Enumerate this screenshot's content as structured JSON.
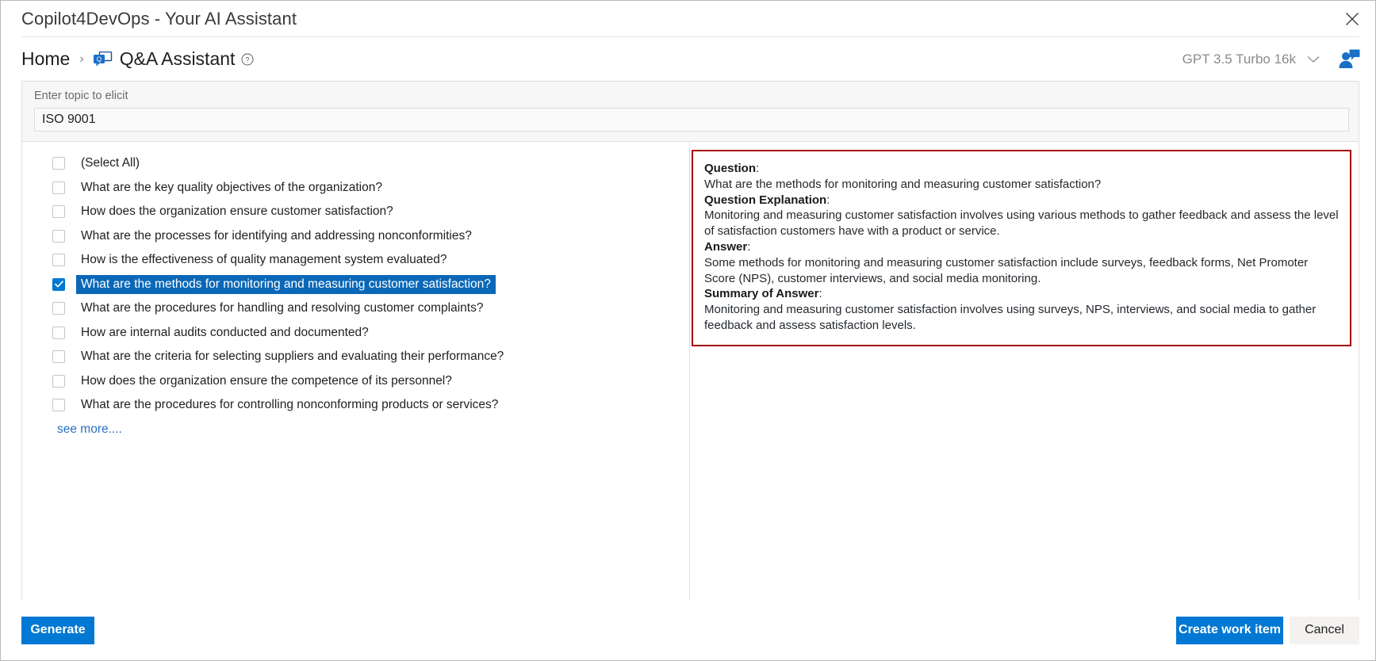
{
  "titlebar": {
    "app_title": "Copilot4DevOps - Your AI Assistant",
    "close_label": "close-icon"
  },
  "breadcrumb": {
    "home": "Home",
    "separator": "›",
    "current": "Q&A Assistant",
    "page_icon": "qa-assistant-icon",
    "help_icon": "help-circle-icon"
  },
  "header_right": {
    "model": "GPT 3.5 Turbo 16k",
    "chevron": "chevron-down-icon",
    "user_icon": "user-chat-icon"
  },
  "topic": {
    "label": "Enter topic to elicit",
    "value": "ISO 9001",
    "placeholder": "Enter topic to elicit"
  },
  "questions": [
    {
      "label": "(Select All)",
      "selected": false
    },
    {
      "label": "What are the key quality objectives of the organization?",
      "selected": false
    },
    {
      "label": "How does the organization ensure customer satisfaction?",
      "selected": false
    },
    {
      "label": "What are the processes for identifying and addressing nonconformities?",
      "selected": false
    },
    {
      "label": "How is the effectiveness of quality management system evaluated?",
      "selected": false
    },
    {
      "label": "What are the methods for monitoring and measuring customer satisfaction?",
      "selected": true
    },
    {
      "label": "What are the procedures for handling and resolving customer complaints?",
      "selected": false
    },
    {
      "label": "How are internal audits conducted and documented?",
      "selected": false
    },
    {
      "label": "What are the criteria for selecting suppliers and evaluating their performance?",
      "selected": false
    },
    {
      "label": "How does the organization ensure the competence of its personnel?",
      "selected": false
    },
    {
      "label": "What are the procedures for controlling nonconforming products or services?",
      "selected": false
    }
  ],
  "see_more": "see more....",
  "answer_card": {
    "question_heading": "Question",
    "question_text": "What are the methods for monitoring and measuring customer satisfaction?",
    "explanation_heading": "Question Explanation",
    "explanation_text": "Monitoring and measuring customer satisfaction involves using various methods to gather feedback and assess the level of satisfaction customers have with a product or service.",
    "answer_heading": "Answer",
    "answer_text": "Some methods for monitoring and measuring customer satisfaction include surveys, feedback forms, Net Promoter Score (NPS), customer interviews, and social media monitoring.",
    "summary_heading": "Summary of Answer",
    "summary_text": "Monitoring and measuring customer satisfaction involves using surveys, NPS, interviews, and social media to gather feedback and assess satisfaction levels.",
    "colon": ":",
    "border_color": "#a4050b"
  },
  "footer": {
    "generate": "Generate",
    "create_work_item": "Create work item",
    "cancel": "Cancel"
  },
  "colors": {
    "accent": "#0078d4",
    "selection": "#0b68b8",
    "link": "#2a6fc2",
    "alert_border": "#a4050b"
  }
}
